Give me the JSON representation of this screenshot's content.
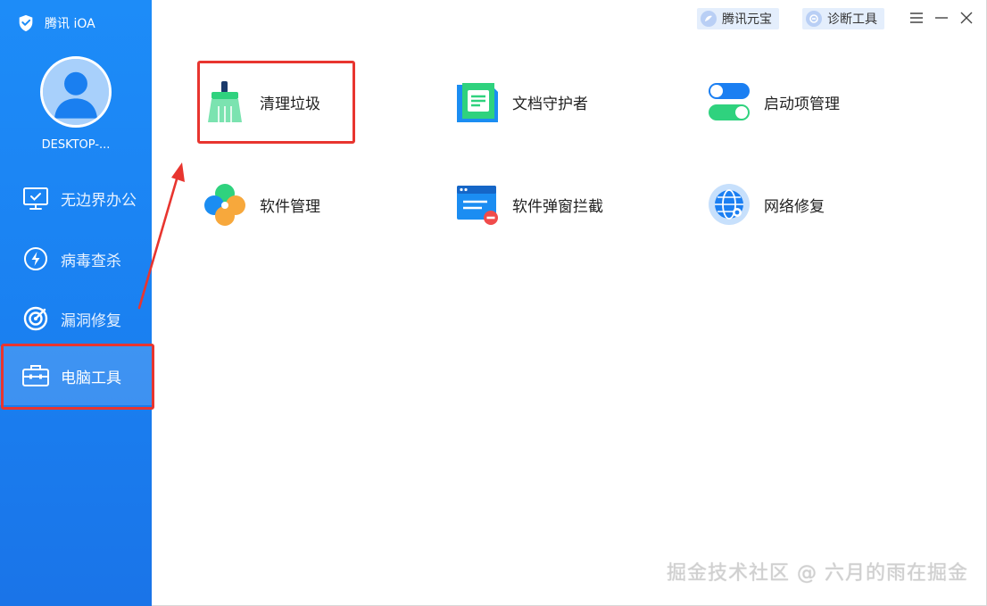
{
  "app": {
    "brand_name": "腾讯 iOA",
    "device_name": "DESKTOP-..."
  },
  "sidebar": {
    "items": [
      {
        "label": "无边界办公",
        "icon": "monitor-check-icon",
        "active": false
      },
      {
        "label": "病毒查杀",
        "icon": "lightning-circle-icon",
        "active": false
      },
      {
        "label": "漏洞修复",
        "icon": "target-icon",
        "active": false
      },
      {
        "label": "电脑工具",
        "icon": "toolbox-icon",
        "active": true
      }
    ]
  },
  "titlebar": {
    "pill_1": "腾讯元宝",
    "pill_2": "诊断工具"
  },
  "tools": [
    {
      "label": "清理垃圾",
      "icon": "broom-icon"
    },
    {
      "label": "文档守护者",
      "icon": "document-icon"
    },
    {
      "label": "启动项管理",
      "icon": "toggle-icon"
    },
    {
      "label": "软件管理",
      "icon": "clover-icon"
    },
    {
      "label": "软件弹窗拦截",
      "icon": "popup-block-icon"
    },
    {
      "label": "网络修复",
      "icon": "globe-icon"
    }
  ],
  "watermark": "掘金技术社区 @ 六月的雨在掘金",
  "colors": {
    "sidebar": "#1d8cf8",
    "highlight": "#e8352f",
    "accent_green": "#2fd27e",
    "accent_blue": "#1a7ff0"
  }
}
